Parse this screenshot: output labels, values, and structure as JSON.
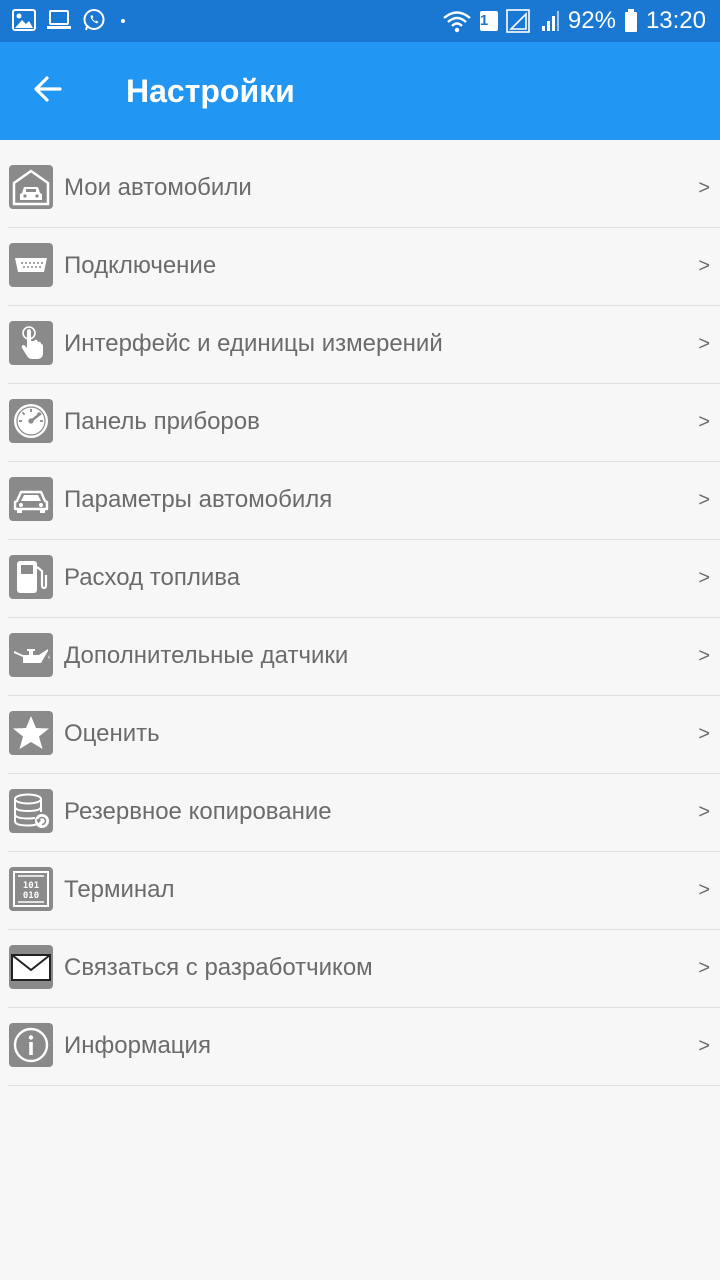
{
  "status_bar": {
    "battery_percent": "92%",
    "time": "13:20",
    "sim_badge": "1"
  },
  "app_bar": {
    "title": "Настройки",
    "back_icon": "arrow-back-icon"
  },
  "settings": {
    "chevron": ">",
    "items": [
      {
        "label": "Мои автомобили",
        "icon": "garage-car-icon"
      },
      {
        "label": "Подключение",
        "icon": "connector-icon"
      },
      {
        "label": "Интерфейс и единицы измерений",
        "icon": "touch-hand-icon"
      },
      {
        "label": "Панель приборов",
        "icon": "gauge-icon"
      },
      {
        "label": "Параметры автомобиля",
        "icon": "car-icon"
      },
      {
        "label": "Расход топлива",
        "icon": "fuel-pump-icon"
      },
      {
        "label": "Дополнительные датчики",
        "icon": "oil-can-icon"
      },
      {
        "label": "Оценить",
        "icon": "star-icon"
      },
      {
        "label": "Резервное копирование",
        "icon": "database-backup-icon"
      },
      {
        "label": "Терминал",
        "icon": "binary-terminal-icon"
      },
      {
        "label": "Связаться с разработчиком",
        "icon": "envelope-icon"
      },
      {
        "label": "Информация",
        "icon": "info-icon"
      }
    ]
  },
  "colors": {
    "status_bar": "#1a78d2",
    "app_bar": "#2196f3",
    "background": "#f7f7f7",
    "icon_tile": "#8a8a8a",
    "label_text": "#6b6b6b"
  }
}
